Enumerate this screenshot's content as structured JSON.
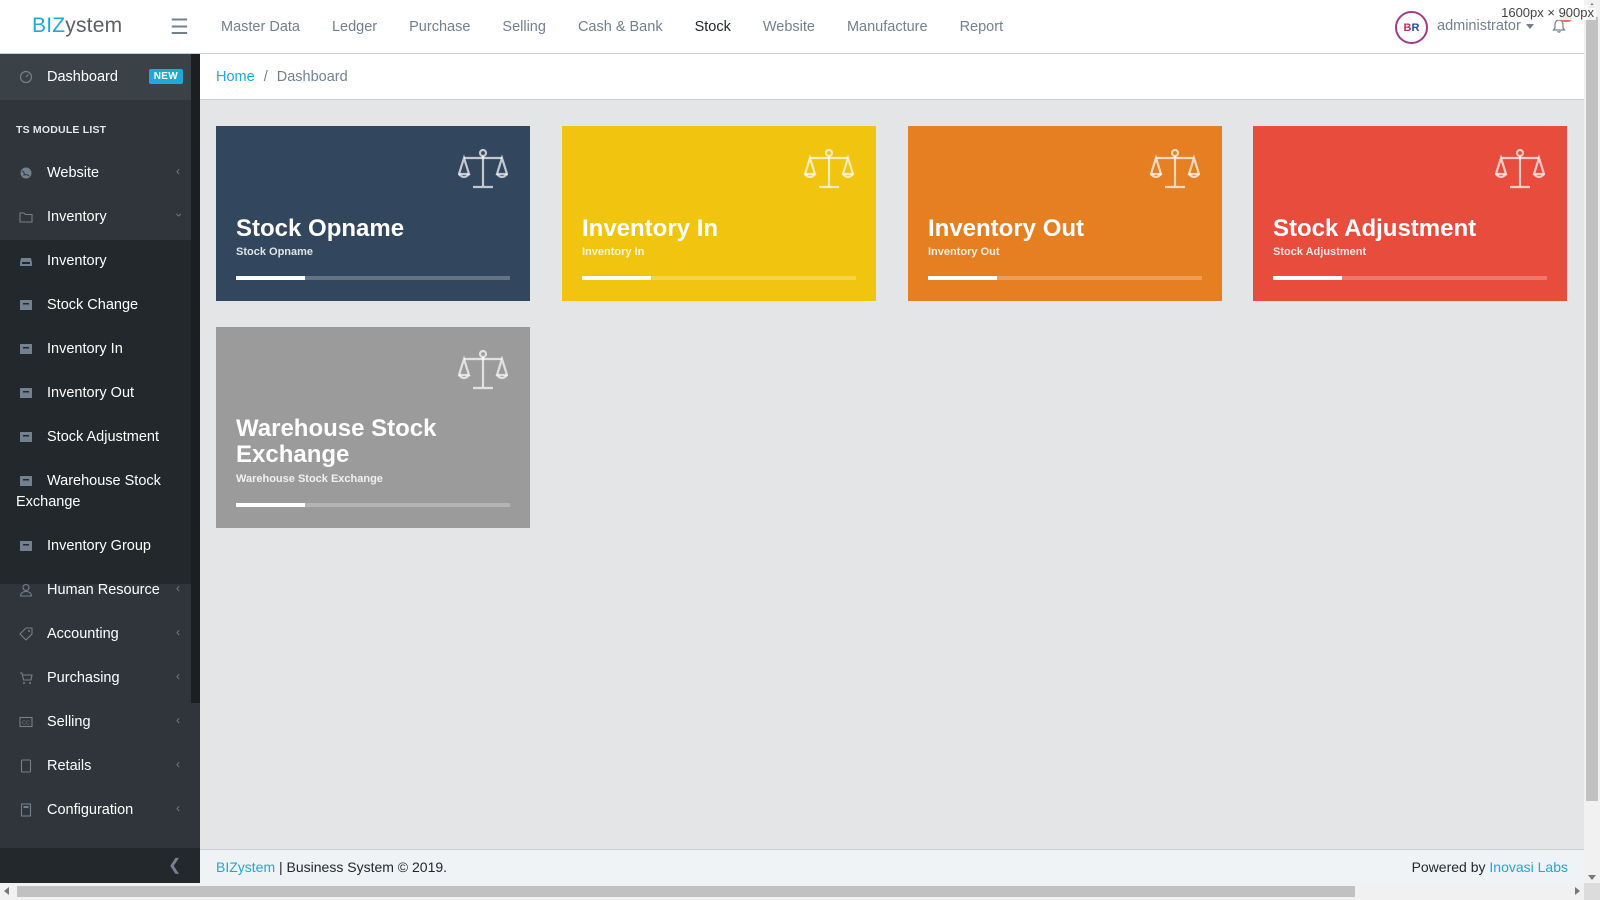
{
  "window": {
    "dimensions_label": "1600px × 900px"
  },
  "header": {
    "brand_prefix": "BIZ",
    "brand_suffix": "ystem",
    "menu_icon": "hamburger-icon",
    "nav": [
      "Master Data",
      "Ledger",
      "Purchase",
      "Selling",
      "Cash & Bank",
      "Stock",
      "Website",
      "Manufacture",
      "Report"
    ],
    "active_nav": "Stock",
    "avatar_text_a": "B",
    "avatar_text_b": "R",
    "user": "administrator",
    "notification_icon": "bell-icon"
  },
  "sidebar": {
    "dashboard": {
      "label": "Dashboard",
      "badge": "NEW",
      "icon": "speedometer-icon"
    },
    "section_title": "TS MODULE LIST",
    "items": [
      {
        "label": "Website",
        "icon": "globe-icon"
      },
      {
        "label": "Inventory",
        "icon": "folder-icon"
      },
      {
        "label": "Inventory",
        "icon": "inbox-icon"
      },
      {
        "label": "Stock Change",
        "icon": "box-icon"
      },
      {
        "label": "Inventory In",
        "icon": "box-icon"
      },
      {
        "label": "Inventory Out",
        "icon": "box-icon"
      },
      {
        "label": "Stock Adjustment",
        "icon": "box-icon"
      },
      {
        "label": "Warehouse Stock",
        "label2": "Exchange",
        "icon": "box-icon"
      },
      {
        "label": "Inventory Group",
        "icon": "box-icon"
      },
      {
        "label": "Human Resource",
        "icon": "user-icon"
      },
      {
        "label": "Accounting",
        "icon": "tag-icon"
      },
      {
        "label": "Purchasing",
        "icon": "cart-icon"
      },
      {
        "label": "Selling",
        "icon": "cc-icon"
      },
      {
        "label": "Retails",
        "icon": "tablet-icon"
      },
      {
        "label": "Configuration",
        "icon": "calculator-icon"
      }
    ]
  },
  "breadcrumb": {
    "home": "Home",
    "separator": "/",
    "current": "Dashboard"
  },
  "cards": [
    {
      "title": "Stock Opname",
      "subtitle": "Stock Opname",
      "color": "#32465d",
      "icon": "balance-scale-icon",
      "progress": 0.25
    },
    {
      "title": "Inventory In",
      "subtitle": "Inventory In",
      "color": "#f0c40f",
      "icon": "balance-scale-icon",
      "progress": 0.25
    },
    {
      "title": "Inventory Out",
      "subtitle": "Inventory Out",
      "color": "#e67e22",
      "icon": "balance-scale-icon",
      "progress": 0.25
    },
    {
      "title": "Stock Adjustment",
      "subtitle": "Stock Adjustment",
      "color": "#e74c3c",
      "icon": "balance-scale-icon",
      "progress": 0.25
    },
    {
      "title_line1": "Warehouse Stock",
      "title_line2": "Exchange",
      "subtitle": "Warehouse Stock Exchange",
      "color": "#9b9b9b",
      "icon": "balance-scale-icon",
      "progress": 0.25
    }
  ],
  "footer": {
    "brand": "BIZystem",
    "text": " | Business System © 2019.",
    "powered": "Powered by ",
    "powered_link": "Inovasi Labs"
  }
}
